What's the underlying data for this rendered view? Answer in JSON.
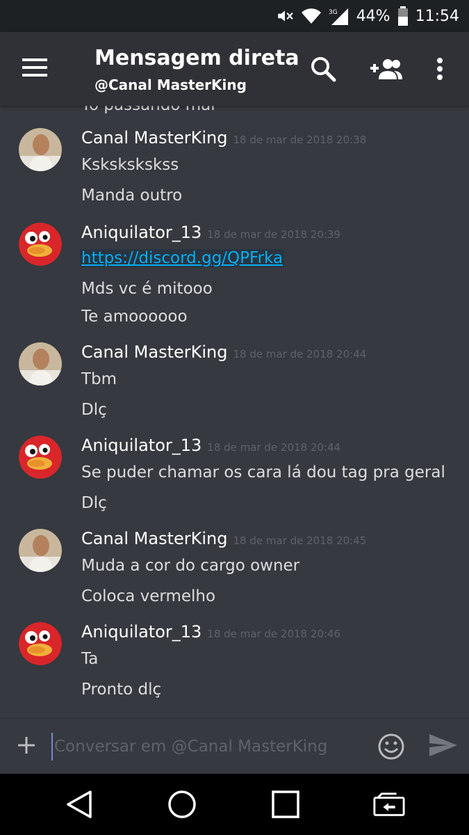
{
  "status_bar": {
    "battery": "44%",
    "time": "11:54",
    "network": "3G"
  },
  "header": {
    "title": "Mensagem direta",
    "subtitle": "@Canal MasterKing"
  },
  "chat": {
    "cut_off_line": "Tô passando mal",
    "groups": [
      {
        "author": "Canal MasterKing",
        "timestamp": "18 de mar de 2018 20:38",
        "avatar": "masterking-avatar",
        "lines": [
          "Kskskskskss",
          "Manda outro"
        ]
      },
      {
        "author": "Aniquilator_13",
        "timestamp": "18 de mar de 2018 20:39",
        "avatar": "aniquilator-avatar",
        "link": "https://discord.gg/QPFrka",
        "lines": [
          "Mds vc é mitooo",
          "Te amoooooo"
        ]
      },
      {
        "author": "Canal MasterKing",
        "timestamp": "18 de mar de 2018 20:44",
        "avatar": "masterking-avatar",
        "lines": [
          "Tbm",
          "Dlç"
        ]
      },
      {
        "author": "Aniquilator_13",
        "timestamp": "18 de mar de 2018 20:44",
        "avatar": "aniquilator-avatar",
        "lines": [
          "Se puder chamar os cara lá dou tag pra geral",
          "Dlç"
        ]
      },
      {
        "author": "Canal MasterKing",
        "timestamp": "18 de mar de 2018 20:45",
        "avatar": "masterking-avatar",
        "lines": [
          "Muda a cor do cargo owner",
          "Coloca vermelho"
        ]
      },
      {
        "author": "Aniquilator_13",
        "timestamp": "18 de mar de 2018 20:46",
        "avatar": "aniquilator-avatar",
        "lines": [
          "Ta",
          "Pronto dlç"
        ]
      }
    ]
  },
  "composer": {
    "placeholder": "Conversar em @Canal MasterKing"
  },
  "colors": {
    "background": "#36393f",
    "header": "#2f3136",
    "link": "#00b0f4",
    "timestamp": "#5f6268"
  },
  "icons": [
    "hamburger-menu-icon",
    "search-icon",
    "add-friend-icon",
    "more-vert-icon",
    "plus-icon",
    "emoji-icon",
    "send-icon",
    "back-nav-icon",
    "home-nav-icon",
    "recents-nav-icon",
    "screen-rotate-icon"
  ]
}
